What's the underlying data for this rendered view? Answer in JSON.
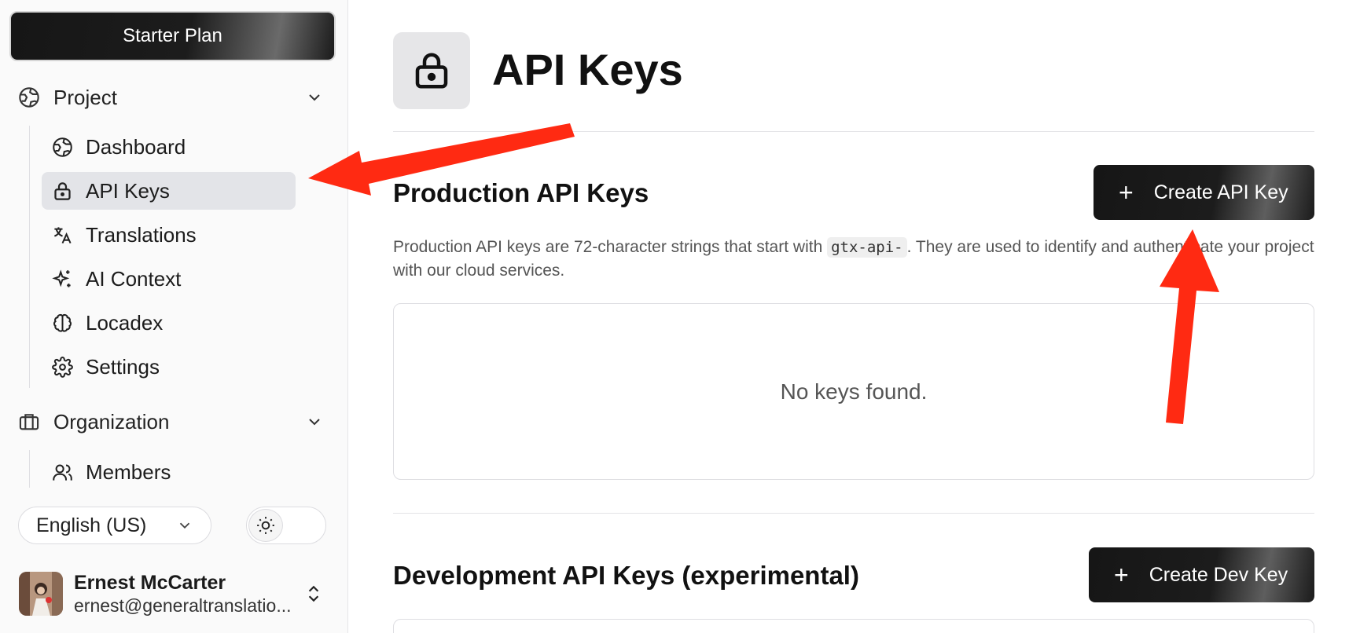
{
  "sidebar": {
    "plan_button": "Starter Plan",
    "project_group": "Project",
    "project_items": [
      {
        "label": "Dashboard",
        "icon": "globe-icon"
      },
      {
        "label": "API Keys",
        "icon": "lock-icon",
        "active": true
      },
      {
        "label": "Translations",
        "icon": "translate-icon"
      },
      {
        "label": "AI Context",
        "icon": "sparkles-icon"
      },
      {
        "label": "Locadex",
        "icon": "brain-icon"
      },
      {
        "label": "Settings",
        "icon": "gear-icon"
      }
    ],
    "organization_group": "Organization",
    "organization_items": [
      {
        "label": "Members",
        "icon": "users-icon"
      }
    ],
    "language": "English (US)",
    "theme": "light",
    "user": {
      "name": "Ernest McCarter",
      "email": "ernest@generaltranslatio..."
    }
  },
  "main": {
    "title": "API Keys",
    "production": {
      "title": "Production API Keys",
      "button": "Create API Key",
      "description_before": "Production API keys are 72-character strings that start with ",
      "prefix": "gtx-api-",
      "description_after": ". They are used to identify and authenticate your project with our cloud services.",
      "empty_text": "No keys found."
    },
    "development": {
      "title": "Development API Keys (experimental)",
      "button": "Create Dev Key"
    }
  },
  "annotations": {
    "arrow_color": "#ff2a12"
  },
  "colors": {
    "active_nav": "#e3e4e8",
    "button_dark": "#1c1c1c"
  }
}
